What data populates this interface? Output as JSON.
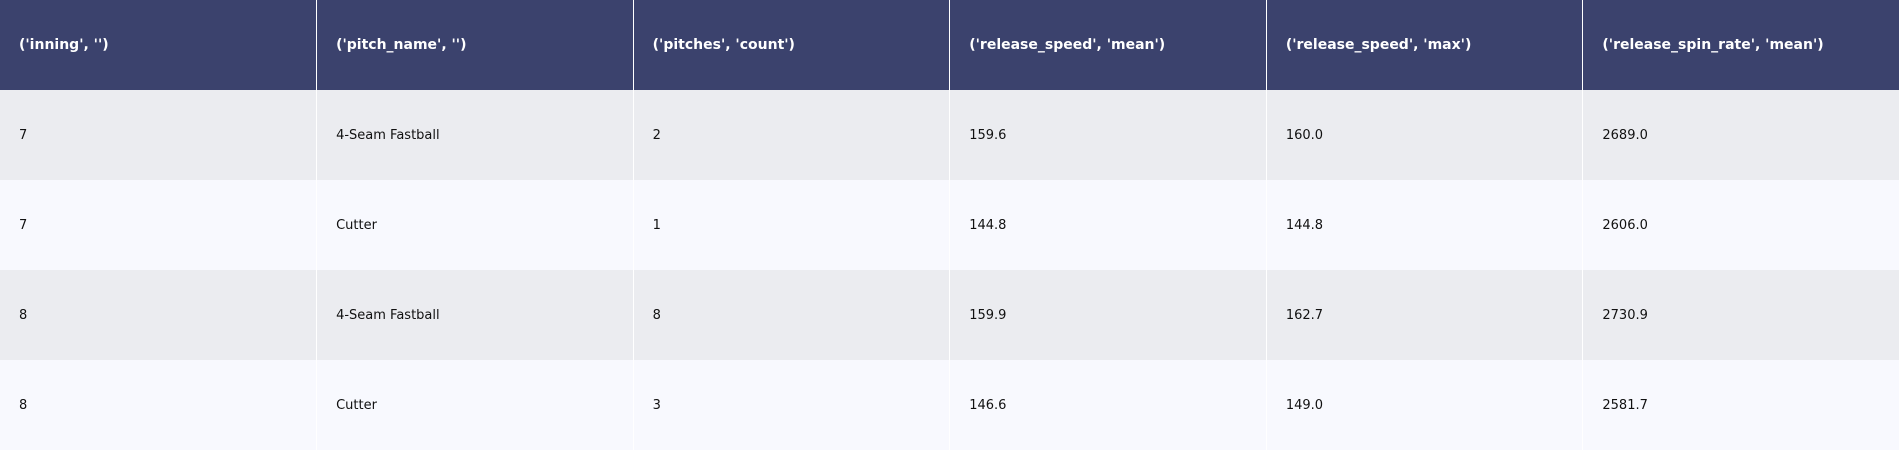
{
  "colors": {
    "header_bg": "#3b426d",
    "header_text": "#ffffff",
    "row_odd_bg": "#ebecf0",
    "row_even_bg": "#f8f9fe",
    "cell_text": "#111111"
  },
  "chart_data": {
    "type": "table",
    "columns": [
      "('inning', '')",
      "('pitch_name', '')",
      "('pitches', 'count')",
      "('release_speed', 'mean')",
      "('release_speed', 'max')",
      "('release_spin_rate', 'mean')"
    ],
    "rows": [
      [
        "7",
        "4-Seam Fastball",
        "2",
        "159.6",
        "160.0",
        "2689.0"
      ],
      [
        "7",
        "Cutter",
        "1",
        "144.8",
        "144.8",
        "2606.0"
      ],
      [
        "8",
        "4-Seam Fastball",
        "8",
        "159.9",
        "162.7",
        "2730.9"
      ],
      [
        "8",
        "Cutter",
        "3",
        "146.6",
        "149.0",
        "2581.7"
      ]
    ]
  }
}
